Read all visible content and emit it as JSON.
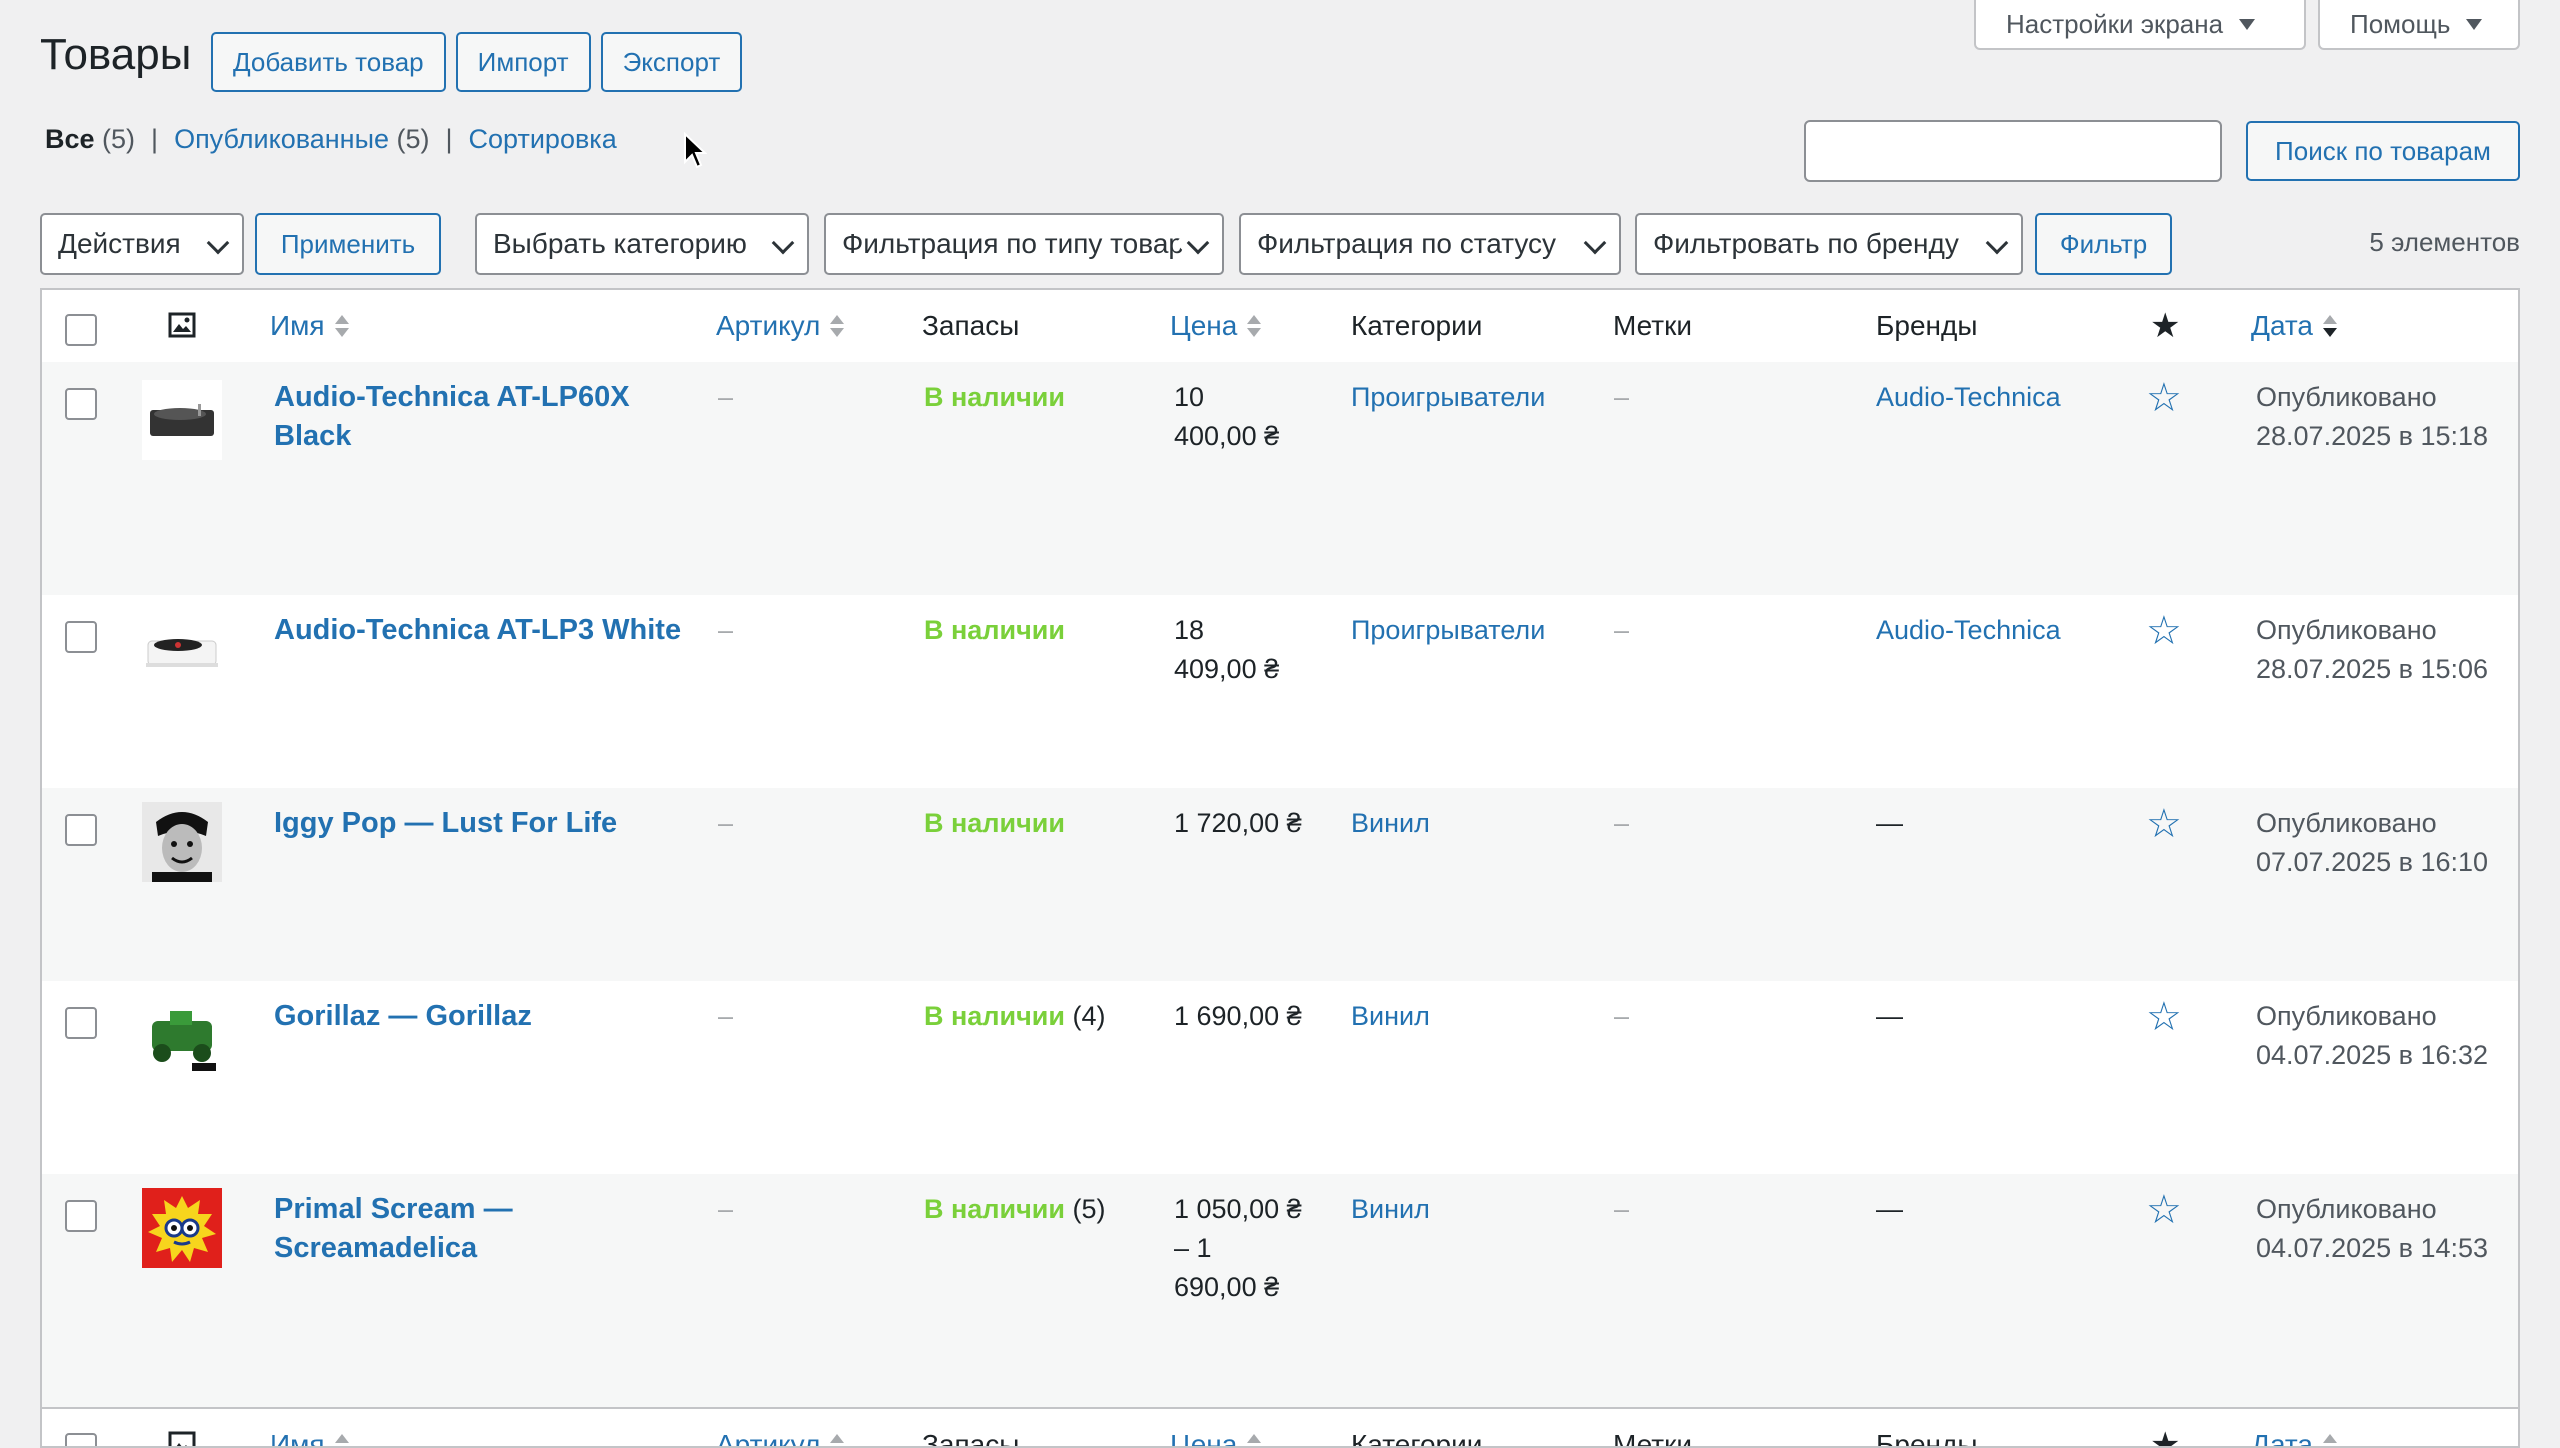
{
  "screen_options": {
    "label": "Настройки экрана"
  },
  "help": {
    "label": "Помощь"
  },
  "page": {
    "title": "Товары",
    "add_button": "Добавить товар",
    "import_button": "Импорт",
    "export_button": "Экспорт"
  },
  "views": {
    "all": {
      "label": "Все",
      "count": "(5)"
    },
    "sep1": "|",
    "published": {
      "label": "Опубликованные",
      "count": "(5)"
    },
    "sep2": "|",
    "sorting": {
      "label": "Сортировка"
    }
  },
  "search": {
    "value": "",
    "button": "Поиск по товарам"
  },
  "filters": {
    "bulk_actions": "Действия",
    "apply": "Применить",
    "category": "Выбрать категорию",
    "product_type": "Фильтрация по типу товара",
    "stock_status": "Фильтрация по статусу",
    "brand": "Фильтровать по бренду",
    "filter_button": "Фильтр",
    "items_count": "5 элементов"
  },
  "columns": {
    "name": "Имя",
    "sku": "Артикул",
    "stock": "Запасы",
    "price": "Цена",
    "categories": "Категории",
    "tags": "Метки",
    "brands": "Бренды",
    "date": "Дата"
  },
  "rows": [
    {
      "name_line1": "Audio-Technica AT-LP60X",
      "name_line2": "Black",
      "sku": "–",
      "stock": "В наличии",
      "stock_count": "",
      "price_line1": "10",
      "price_line2": "400,00 ₴",
      "price_line3": "",
      "category": "Проигрыватели",
      "tags": "–",
      "brand": "Audio-Technica",
      "date_status": "Опубликовано",
      "date_value": "28.07.2025 в 15:18"
    },
    {
      "name_line1": "Audio-Technica AT-LP3 White",
      "name_line2": "",
      "sku": "–",
      "stock": "В наличии",
      "stock_count": "",
      "price_line1": "18",
      "price_line2": "409,00 ₴",
      "price_line3": "",
      "category": "Проигрыватели",
      "tags": "–",
      "brand": "Audio-Technica",
      "date_status": "Опубликовано",
      "date_value": "28.07.2025 в 15:06"
    },
    {
      "name_line1": "Iggy Pop — Lust For Life",
      "name_line2": "",
      "sku": "–",
      "stock": "В наличии",
      "stock_count": "",
      "price_line1": "1 720,00 ₴",
      "price_line2": "",
      "price_line3": "",
      "category": "Винил",
      "tags": "–",
      "brand": "—",
      "date_status": "Опубликовано",
      "date_value": "07.07.2025 в 16:10"
    },
    {
      "name_line1": "Gorillaz — Gorillaz",
      "name_line2": "",
      "sku": "–",
      "stock": "В наличии",
      "stock_count": "(4)",
      "price_line1": "1 690,00 ₴",
      "price_line2": "",
      "price_line3": "",
      "category": "Винил",
      "tags": "–",
      "brand": "—",
      "date_status": "Опубликовано",
      "date_value": "04.07.2025 в 16:32"
    },
    {
      "name_line1": "Primal Scream —",
      "name_line2": "Screamadelica",
      "sku": "–",
      "stock": "В наличии",
      "stock_count": "(5)",
      "price_line1": "1 050,00 ₴",
      "price_line2": "– 1",
      "price_line3": "690,00 ₴",
      "category": "Винил",
      "tags": "–",
      "brand": "—",
      "date_status": "Опубликовано",
      "date_value": "04.07.2025 в 14:53"
    }
  ],
  "footer_columns": {
    "name": "Имя",
    "sku": "Артикул",
    "stock": "Запасы",
    "price": "Цена",
    "categories": "Категории",
    "tags": "Метки",
    "brands": "Бренды",
    "date": "Дата"
  },
  "colors": {
    "link": "#2271b1",
    "in_stock": "#7ad03a",
    "background": "#f0f0f1"
  }
}
